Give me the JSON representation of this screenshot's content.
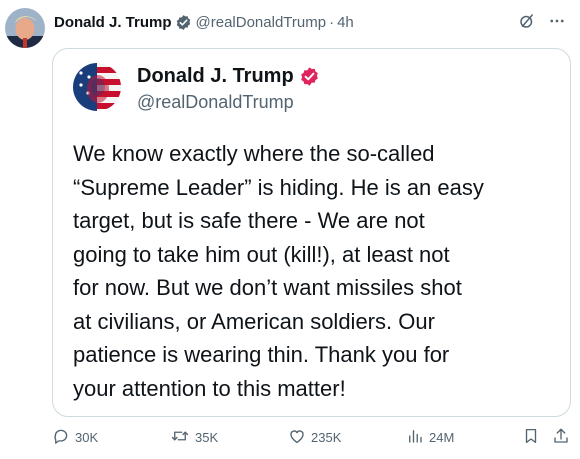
{
  "post": {
    "author_name": "Donald J. Trump",
    "handle": "@realDonaldTrump",
    "separator": "·",
    "time": "4h"
  },
  "quoted": {
    "author_name": "Donald J. Trump",
    "handle": "@realDonaldTrump",
    "text_lines": [
      "We know exactly where the so-called",
      "“Supreme Leader” is hiding. He is an easy",
      "target, but is safe there - We are not",
      "going to take him out (kill!), at least not",
      "for now. But we don’t want missiles shot",
      "at civilians, or American soldiers. Our",
      "patience is wearing thin. Thank you for",
      "your attention to this matter!"
    ]
  },
  "actions": {
    "replies": "30K",
    "reposts": "35K",
    "likes": "235K",
    "views": "24M"
  },
  "colors": {
    "text": "#0f1419",
    "secondary": "#536471",
    "border": "#cfd9de",
    "verified": "#e0245e"
  },
  "icons": [
    "grok-icon",
    "more-icon",
    "verified-icon",
    "reply-icon",
    "repost-icon",
    "like-icon",
    "views-icon",
    "bookmark-icon",
    "share-icon"
  ]
}
